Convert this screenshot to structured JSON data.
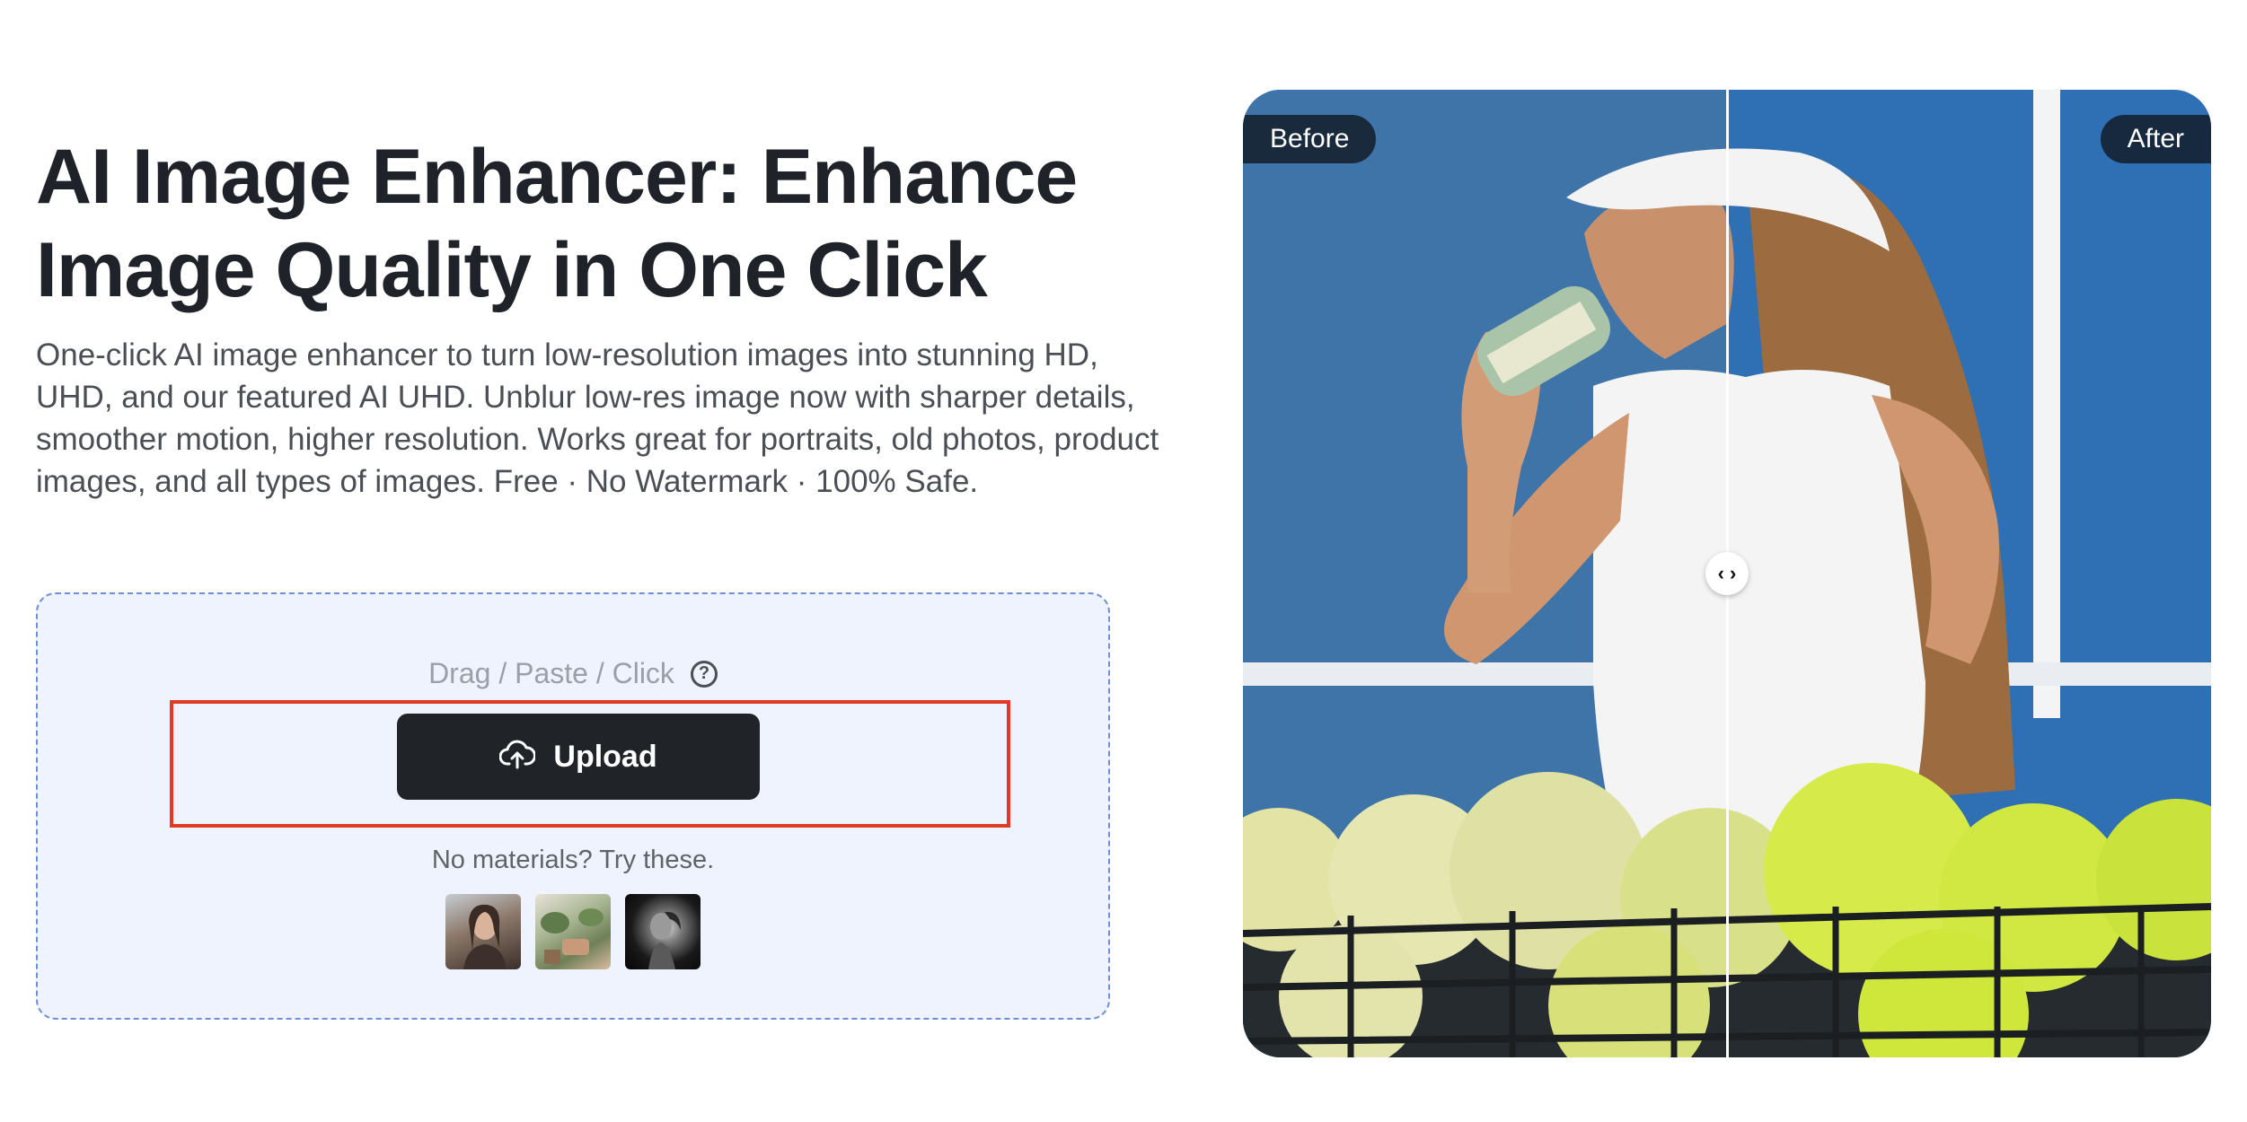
{
  "hero": {
    "title": "AI Image Enhancer: Enhance Image Quality in One Click",
    "description": "One-click AI image enhancer to turn low-resolution images into stunning HD, UHD, and our featured AI UHD. Unblur low-res image now with sharper details, smoother motion, higher resolution. Works great for portraits, old photos, product images, and all types of images. Free · No Watermark · 100% Safe."
  },
  "upload_zone": {
    "hint": "Drag / Paste / Click",
    "help_icon": "?",
    "upload_label": "Upload",
    "samples_text": "No materials? Try these.",
    "samples": [
      {
        "icon": "portrait-woman-thumbnail"
      },
      {
        "icon": "interior-plants-thumbnail"
      },
      {
        "icon": "bw-portrait-thumbnail"
      }
    ]
  },
  "comparison": {
    "before_label": "Before",
    "after_label": "After",
    "handle_glyph": "‹ ›"
  },
  "colors": {
    "accent_dark": "#202327",
    "highlight_red": "#e03a26",
    "zone_bg": "#eff3fd",
    "zone_border": "#6f8fd6",
    "court_blue": "#2f6fb3"
  }
}
